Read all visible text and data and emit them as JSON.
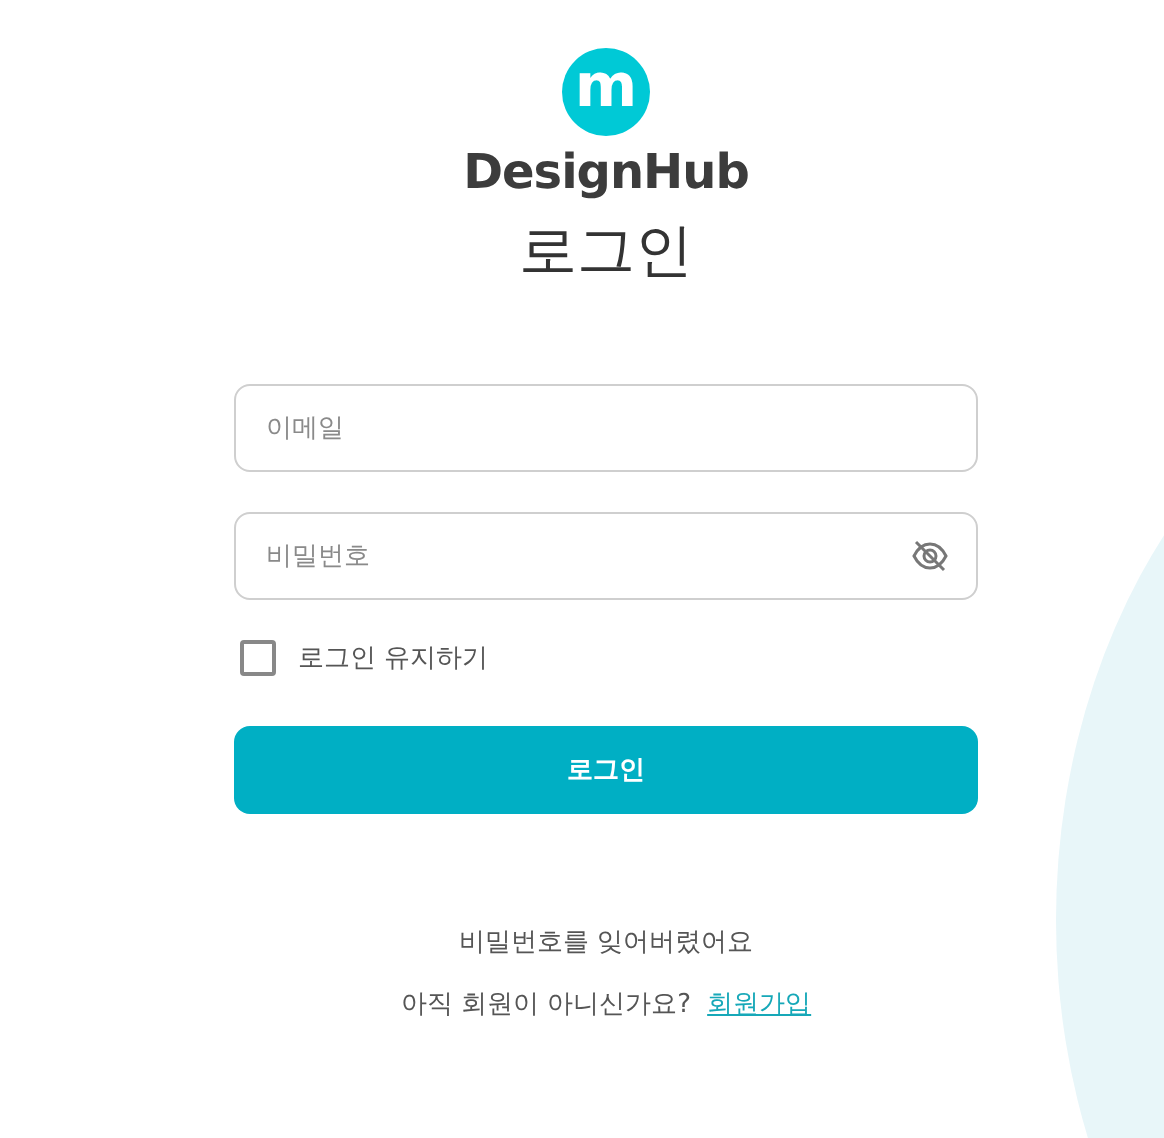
{
  "logo": {
    "mark": "m",
    "name": "DesignHub"
  },
  "title": "로그인",
  "fields": [
    {
      "kind": "text",
      "placeholder": "이메일"
    },
    {
      "kind": "password",
      "placeholder": "비밀번호"
    }
  ],
  "remember": {
    "label": "로그인 유지하기",
    "checked": false
  },
  "submit_button": "로그인",
  "forgot_link": "비밀번호를 잊어버렸어요",
  "signup": {
    "prompt": "아직 회원이 아니신가요?",
    "link": "회원가입"
  }
}
